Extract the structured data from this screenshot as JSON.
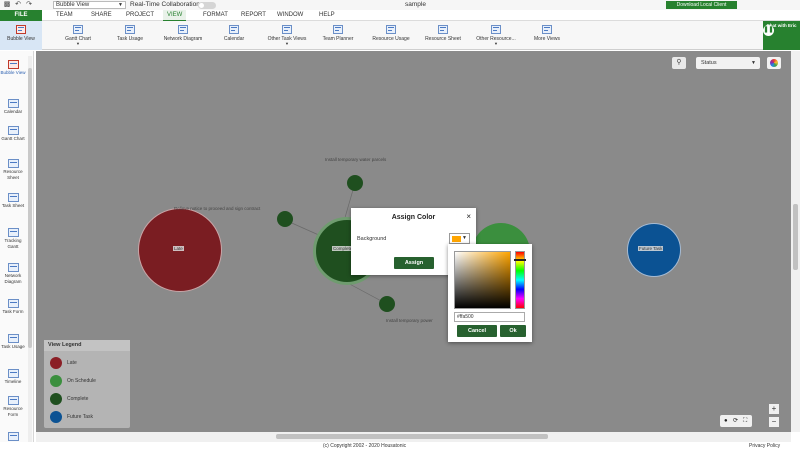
{
  "topbar": {
    "view_select": "Bubble View",
    "realtime_label": "Real-Time Collaboration",
    "doc_title": "sample",
    "download_label": "Download Local Client"
  },
  "menu": {
    "file": "FILE",
    "tabs": [
      "TEAM",
      "SHARE",
      "PROJECT",
      "VIEW",
      "FORMAT",
      "REPORT",
      "WINDOW",
      "HELP"
    ],
    "active": "VIEW"
  },
  "ribbon": {
    "bubble_view": "Bubble View",
    "buttons": [
      "Gantt Chart",
      "Task Usage",
      "Network Diagram",
      "Calendar",
      "Other Task Views",
      "Team Planner",
      "Resource Usage",
      "Resource Sheet",
      "Other Resource...",
      "More Views"
    ],
    "chat_label": "Chat with Eric"
  },
  "left_panel": {
    "items": [
      "Bubble View",
      "Calendar",
      "Gantt Chart",
      "Resource Sheet",
      "Task Sheet",
      "Tracking Gantt",
      "Network Diagram",
      "Task Form",
      "Task Usage",
      "Timeline",
      "Resource Form"
    ]
  },
  "canvas": {
    "status_select": "Status",
    "bubbles": {
      "late": "Late",
      "complete": "Complete",
      "future": "Future Task"
    },
    "task_labels": {
      "water_parcels": "Install temporary water parcels",
      "notice": "Relieve notice to proceed and sign contract",
      "power": "Install temporary power"
    }
  },
  "legend": {
    "title": "View Legend",
    "items": [
      {
        "label": "Late",
        "color": "#8b1f26"
      },
      {
        "label": "On Schedule",
        "color": "#3b8f3e"
      },
      {
        "label": "Complete",
        "color": "#1f4f1f"
      },
      {
        "label": "Future Task",
        "color": "#0b5293"
      }
    ]
  },
  "assign_color": {
    "title": "Assign Color",
    "close": "×",
    "background_label": "Background",
    "swatch_color": "#ffa500",
    "assign_button": "Assign"
  },
  "color_picker": {
    "hex_value": "#ffa500",
    "cancel": "Cancel",
    "ok": "Ok"
  },
  "footer": {
    "copyright": "(c) Copyright 2002 - 2020 Housatonic",
    "privacy": "Privacy Policy"
  },
  "colors": {
    "brand_green": "#27812f",
    "canvas_gray": "#8a8a8a"
  }
}
